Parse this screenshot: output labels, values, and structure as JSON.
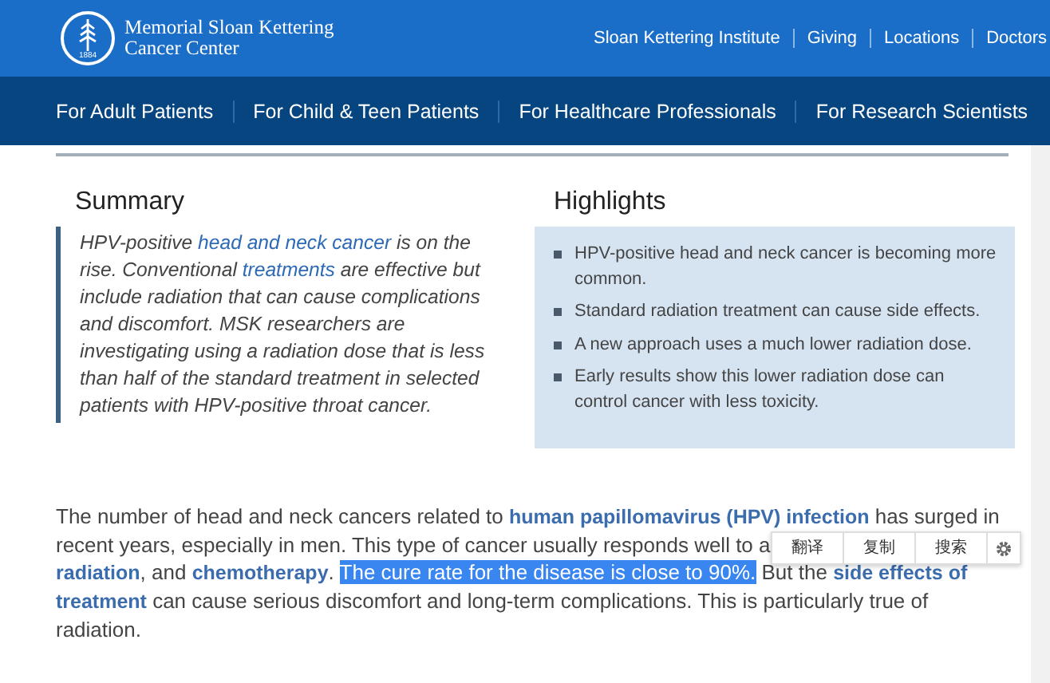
{
  "header": {
    "logo_year": "1884",
    "logo_name": [
      "Memorial Sloan Kettering",
      "Cancer Center"
    ],
    "utility_links": [
      "Sloan Kettering Institute",
      "Giving",
      "Locations",
      "Doctors"
    ]
  },
  "nav": {
    "items": [
      "For Adult Patients",
      "For Child & Teen Patients",
      "For Healthcare Professionals",
      "For Research Scientists"
    ]
  },
  "summary": {
    "title": "Summary",
    "segments": [
      {
        "kind": "text",
        "text": "HPV-positive "
      },
      {
        "kind": "link",
        "text": "head and neck cancer"
      },
      {
        "kind": "text",
        "text": " is on the rise. Conventional "
      },
      {
        "kind": "link",
        "text": "treatments"
      },
      {
        "kind": "text",
        "text": " are effective but include radiation that can cause complications and discomfort. MSK researchers are investigating using a radiation dose that is less than half of the standard treatment in selected patients with HPV-positive throat cancer."
      }
    ]
  },
  "highlights": {
    "title": "Highlights",
    "items": [
      "HPV-positive head and neck cancer is becoming more common.",
      "Standard radiation treatment can cause side effects.",
      "A new approach uses a much lower radiation dose.",
      "Early results show this lower radiation dose can control cancer with less toxicity."
    ]
  },
  "body": {
    "lines": [
      [
        {
          "kind": "text",
          "text": "The number of head and neck cancers related to "
        },
        {
          "kind": "link",
          "text": "human papillomavirus (HPV) infection"
        },
        {
          "kind": "text",
          "text": " has surged in"
        }
      ],
      [
        {
          "kind": "text",
          "text": "recent years, especially in men. This type of cancer usually responds well to a"
        }
      ],
      [
        {
          "kind": "link",
          "text": "radiation"
        },
        {
          "kind": "text",
          "text": ", and "
        },
        {
          "kind": "link",
          "text": "chemotherapy"
        },
        {
          "kind": "text",
          "text": ". "
        },
        {
          "kind": "selection",
          "text": "The cure rate for the disease is close to 90%."
        },
        {
          "kind": "text",
          "text": " But the "
        },
        {
          "kind": "link",
          "text": "side effects of"
        }
      ],
      [
        {
          "kind": "link",
          "text": "treatment"
        },
        {
          "kind": "text",
          "text": " can cause serious discomfort and long-term complications. This is particularly true of"
        }
      ],
      [
        {
          "kind": "text",
          "text": "radiation."
        }
      ]
    ]
  },
  "selection_toolbar": {
    "buttons": [
      "翻译",
      "复制",
      "搜索"
    ]
  }
}
